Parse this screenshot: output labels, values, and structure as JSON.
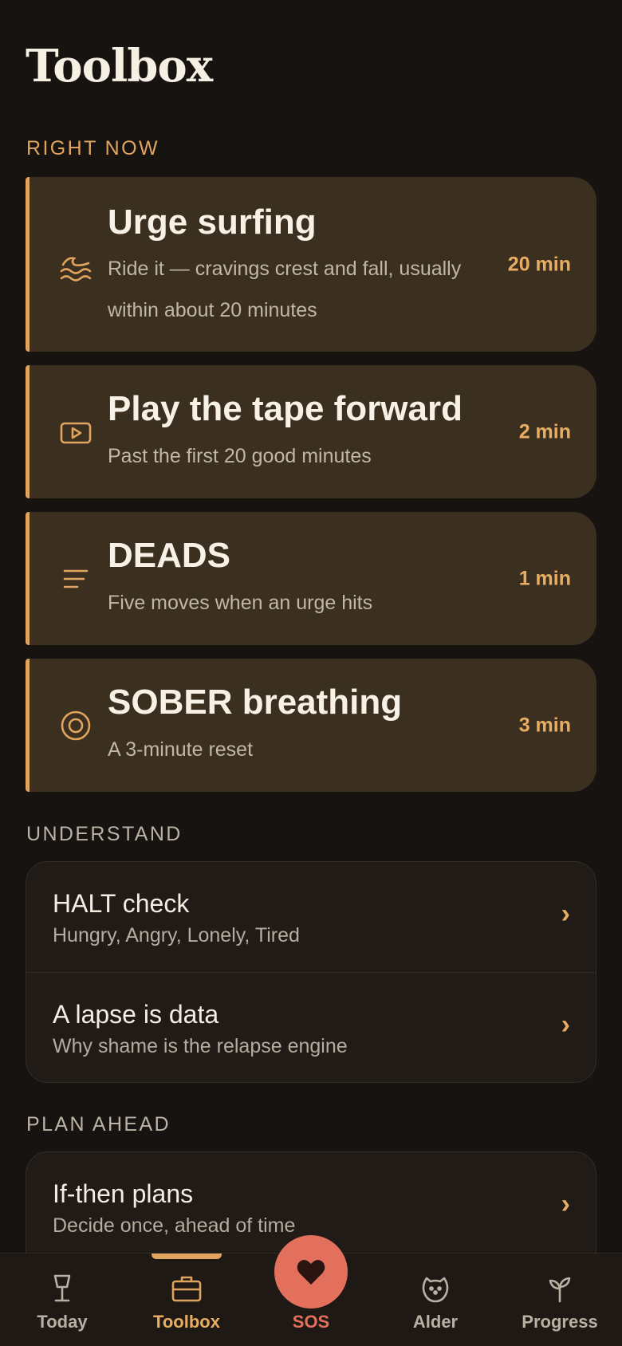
{
  "header": {
    "title": "Toolbox"
  },
  "sections": {
    "right_now": "RIGHT NOW",
    "understand": "UNDERSTAND",
    "plan_ahead": "PLAN AHEAD"
  },
  "right_now_cards": [
    {
      "title": "Urge surfing",
      "subtitle": "Ride it — cravings crest and fall, usually within about 20 minutes",
      "time": "20 min",
      "icon": "waves-icon"
    },
    {
      "title": "Play the tape forward",
      "subtitle": "Past the first 20 good minutes",
      "time": "2 min",
      "icon": "play-icon"
    },
    {
      "title": "DEADS",
      "subtitle": "Five moves when an urge hits",
      "time": "1 min",
      "icon": "list-icon"
    },
    {
      "title": "SOBER breathing",
      "subtitle": "A 3-minute reset",
      "time": "3 min",
      "icon": "target-icon"
    }
  ],
  "understand_items": [
    {
      "title": "HALT check",
      "subtitle": "Hungry, Angry, Lonely, Tired"
    },
    {
      "title": "A lapse is data",
      "subtitle": "Why shame is the relapse engine"
    }
  ],
  "plan_items": [
    {
      "title": "If-then plans",
      "subtitle": "Decide once, ahead of time"
    }
  ],
  "chevron": "›",
  "nav": {
    "today": "Today",
    "toolbox": "Toolbox",
    "sos": "SOS",
    "alder": "Alder",
    "progress": "Progress",
    "active": "toolbox"
  },
  "colors": {
    "accent": "#e0a45e",
    "sos": "#e3705c",
    "background": "#161311",
    "card": "#3b3020"
  }
}
